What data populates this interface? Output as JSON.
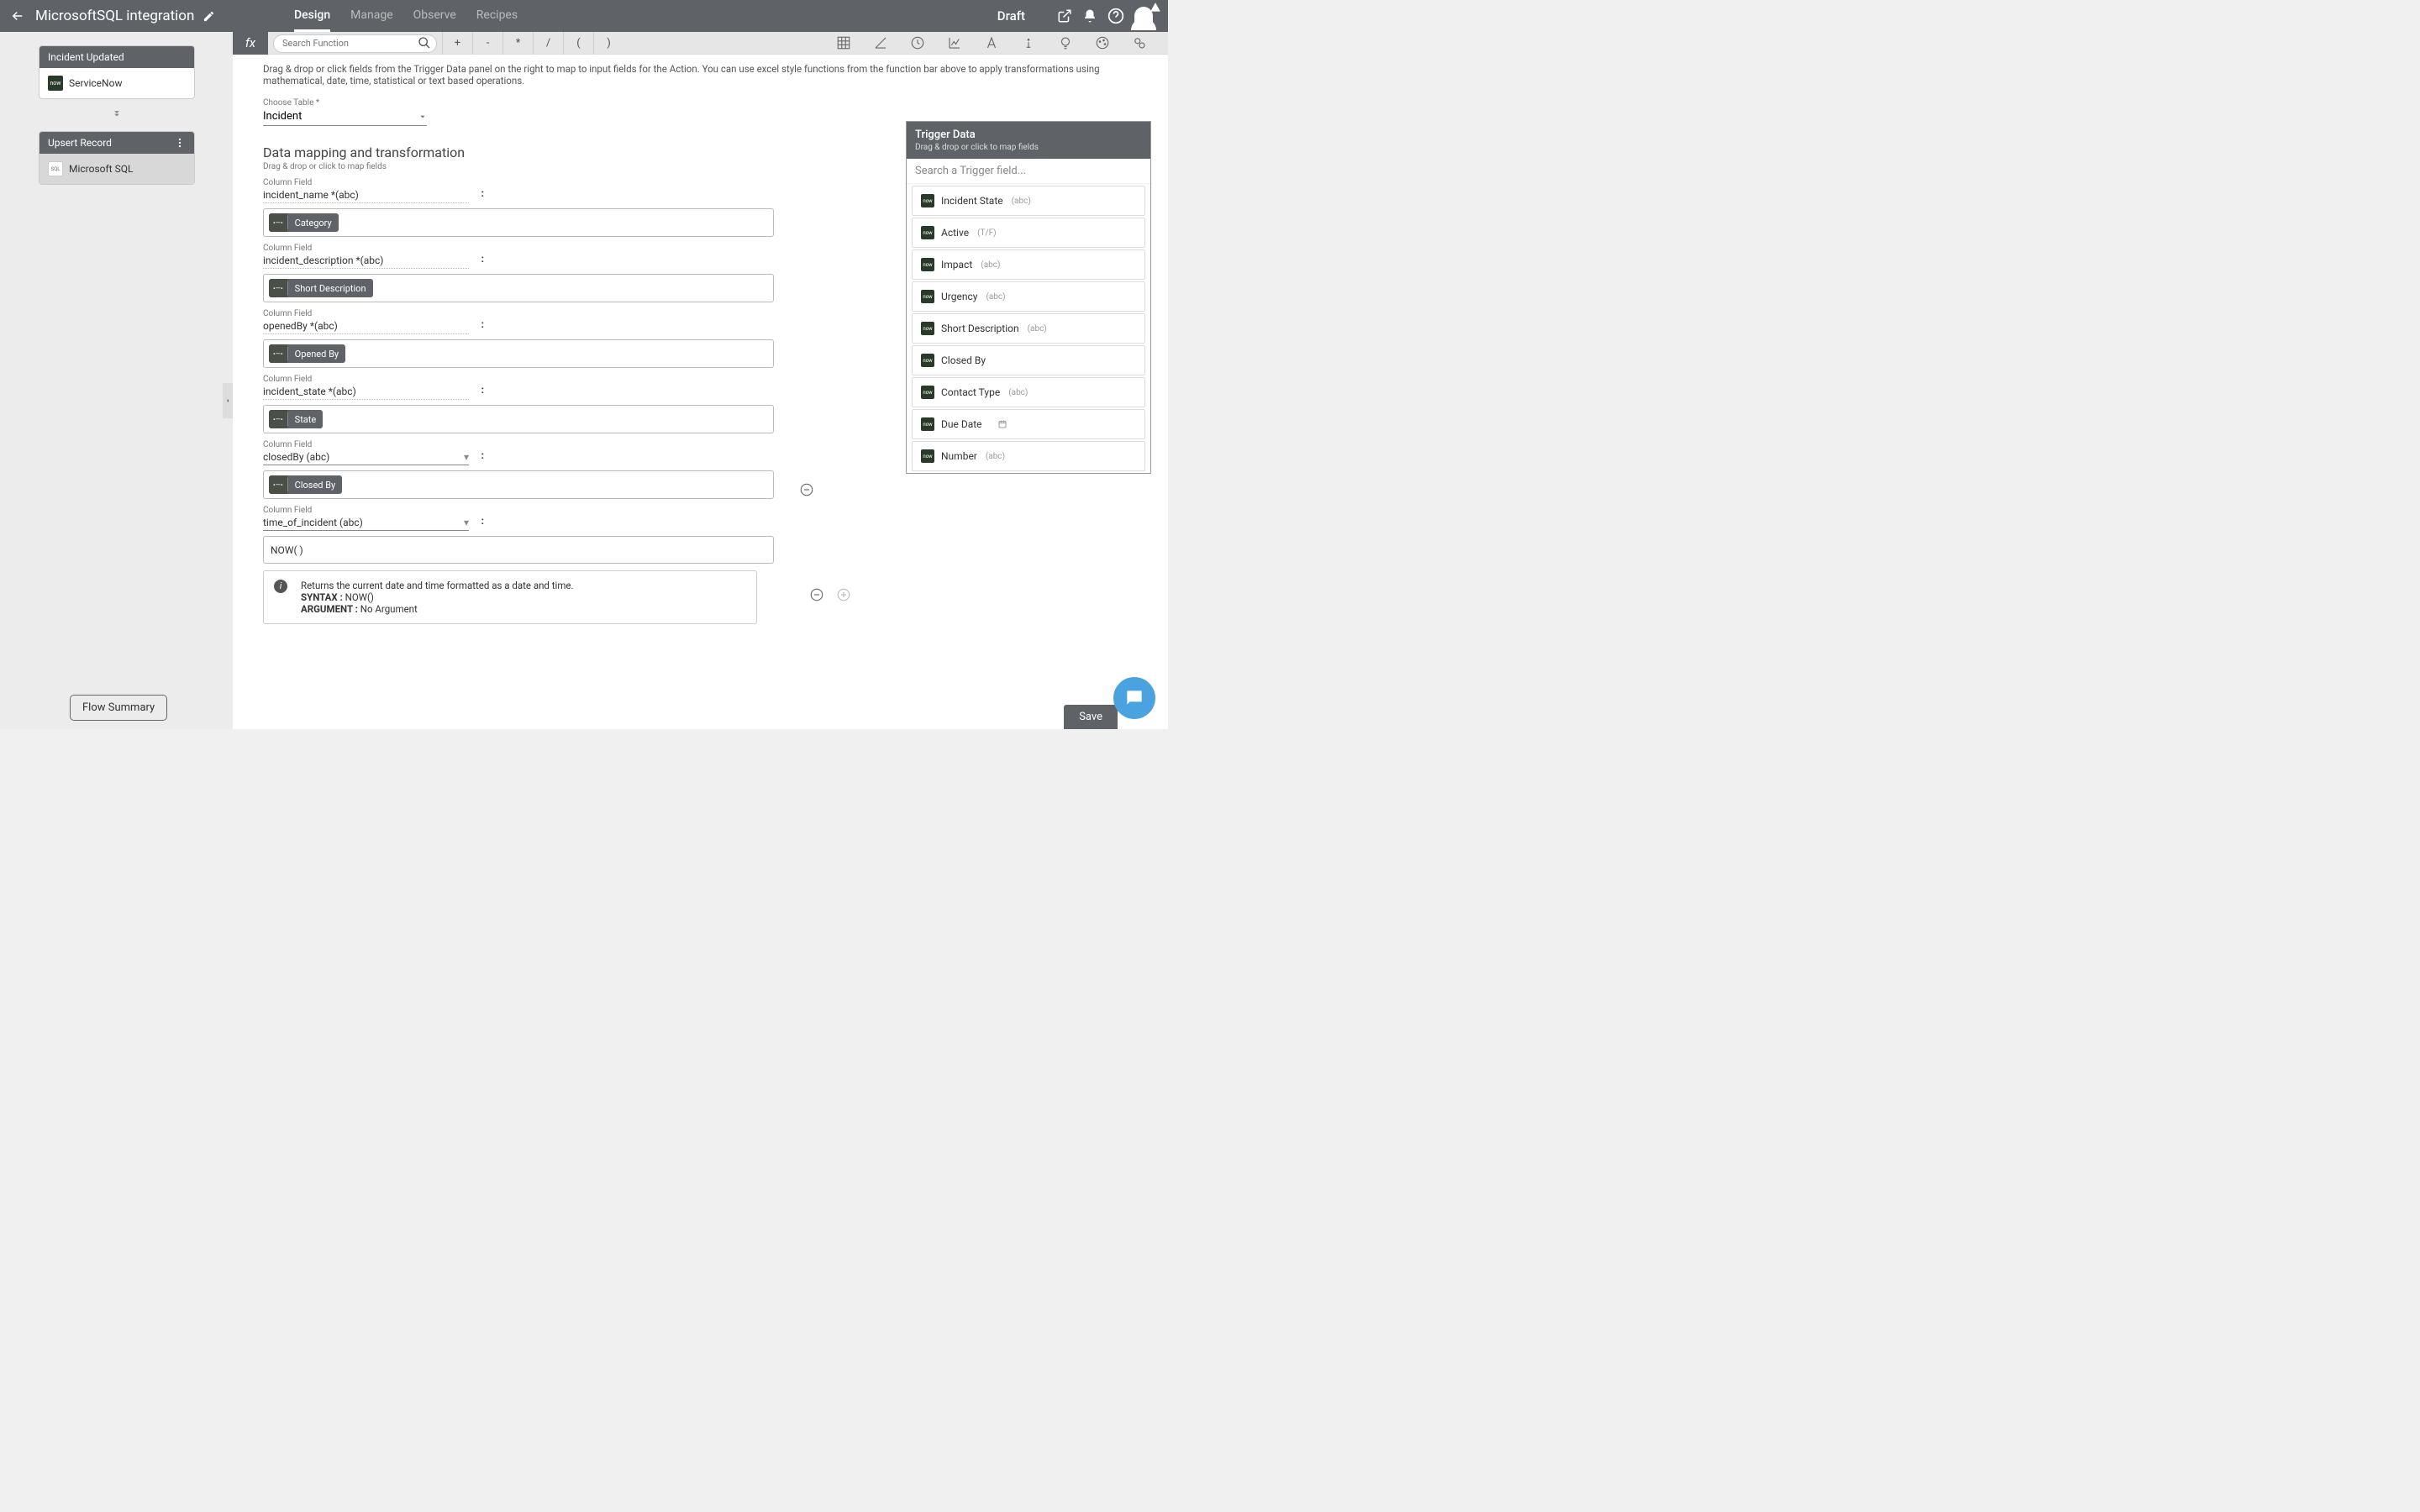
{
  "header": {
    "title": "MicrosoftSQL integration",
    "tabs": [
      "Design",
      "Manage",
      "Observe",
      "Recipes"
    ],
    "active_tab": 0,
    "status": "Draft"
  },
  "sidebar": {
    "trigger": {
      "title": "Incident Updated",
      "source": "ServiceNow"
    },
    "action": {
      "title": "Upsert Record",
      "source": "Microsoft SQL"
    },
    "flow_summary_btn": "Flow Summary"
  },
  "fxbar": {
    "search_placeholder": "Search Function",
    "ops": [
      "+",
      "-",
      "*",
      "/",
      "(",
      ")"
    ]
  },
  "help_text": "Drag & drop or click fields from the Trigger Data panel on the right to map to input fields for the Action. You can use excel style functions from the function bar above to apply transformations using mathematical, date, time, statistical or text based operations.",
  "table": {
    "label": "Choose Table *",
    "value": "Incident"
  },
  "section": {
    "title": "Data mapping and transformation",
    "subtitle": "Drag & drop or click to map fields"
  },
  "mappings": [
    {
      "label": "Column Field",
      "field": "incident_name *(abc)",
      "dropdown": false,
      "chip": "Category",
      "chip_type": "pill"
    },
    {
      "label": "Column Field",
      "field": "incident_description *(abc)",
      "dropdown": false,
      "chip": "Short Description",
      "chip_type": "pill"
    },
    {
      "label": "Column Field",
      "field": "openedBy *(abc)",
      "dropdown": false,
      "chip": "Opened By",
      "chip_type": "pill"
    },
    {
      "label": "Column Field",
      "field": "incident_state *(abc)",
      "dropdown": false,
      "chip": "State",
      "chip_type": "pill"
    },
    {
      "label": "Column Field",
      "field": "closedBy (abc)",
      "dropdown": true,
      "chip": "Closed By",
      "chip_type": "pill",
      "remove": true
    },
    {
      "label": "Column Field",
      "field": "time_of_incident (abc)",
      "dropdown": true,
      "chip": "NOW( )",
      "chip_type": "text",
      "remove": true,
      "add": true
    }
  ],
  "help_box": {
    "desc": "Returns the current date and time formatted as a date and time.",
    "syntax_label": "SYNTAX :",
    "syntax_val": "NOW()",
    "arg_label": "ARGUMENT :",
    "arg_val": "No Argument"
  },
  "trigger_panel": {
    "title": "Trigger Data",
    "subtitle": "Drag & drop or click to map fields",
    "search_placeholder": "Search a Trigger field...",
    "items": [
      {
        "name": "Incident State",
        "type": "(abc)"
      },
      {
        "name": "Active",
        "type": "(T/F)"
      },
      {
        "name": "Impact",
        "type": "(abc)"
      },
      {
        "name": "Urgency",
        "type": "(abc)"
      },
      {
        "name": "Short Description",
        "type": "(abc)"
      },
      {
        "name": "Closed By",
        "type": ""
      },
      {
        "name": "Contact Type",
        "type": "(abc)"
      },
      {
        "name": "Due Date",
        "type": "",
        "icon": "date"
      },
      {
        "name": "Number",
        "type": "(abc)"
      }
    ]
  },
  "save_btn": "Save"
}
